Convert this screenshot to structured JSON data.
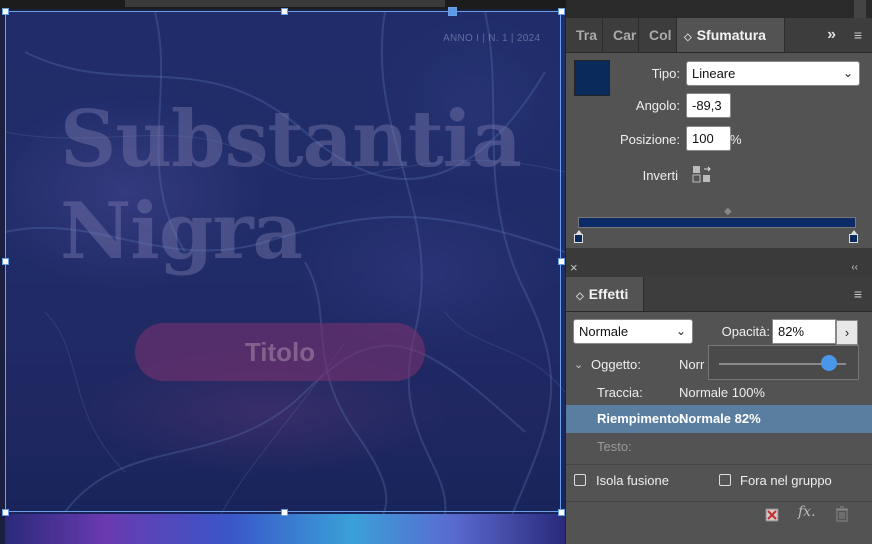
{
  "canvas": {
    "issue_text": "ANNO I | N. 1 | 2024",
    "title_line1": "Substantia",
    "title_line2": "Nigra",
    "pill_label": "Titolo"
  },
  "gradient_panel": {
    "tabs": [
      "Tra",
      "Car",
      "Col"
    ],
    "active_tab": "Sfumatura",
    "overflow": "»",
    "menu": "≡",
    "swatch_color": "#0a2a5c",
    "type_label": "Tipo:",
    "type_value": "Lineare",
    "angle_label": "Angolo:",
    "angle_value": "-89,3",
    "position_label": "Posizione:",
    "position_value": "100",
    "position_unit": "%",
    "invert_label": "Inverti"
  },
  "effects_panel": {
    "tab": "Effetti",
    "menu": "≡",
    "close": "×",
    "collapse": "‹‹",
    "blend_mode": "Normale",
    "opacity_label": "Opacità:",
    "opacity_value": "82%",
    "opacity_level": 0.82,
    "object_label": "Oggetto:",
    "object_value": "Norr",
    "stroke_label": "Traccia:",
    "stroke_value": "Normale 100%",
    "fill_label": "Riempimento:",
    "fill_value": "Normale 82%",
    "text_label": "Testo:",
    "isolate_label": "Isola fusione",
    "knockout_label": "Fora nel gruppo",
    "fx_label": "fx."
  },
  "colors": {
    "accent": "#4a96e8",
    "selection_row": "#5a7ea0",
    "panel_bg": "#535353"
  }
}
